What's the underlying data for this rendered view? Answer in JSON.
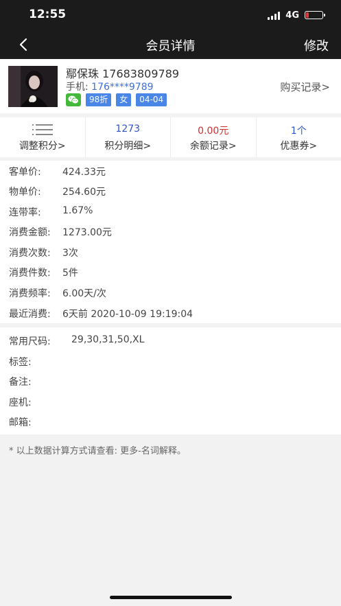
{
  "status_bar": {
    "time": "12:55",
    "network": "4G",
    "battery_color": "#e0383a"
  },
  "nav": {
    "title": "会员详情",
    "edit_label": "修改",
    "back_icon": "chevron-left-icon"
  },
  "profile": {
    "name_line": "鄢保珠 17683809789",
    "phone_label": "手机:",
    "phone_value": "176****9789",
    "tags": [
      "98折",
      "女",
      "04-04"
    ],
    "buy_record_label": "购买记录>"
  },
  "stats": [
    {
      "value": "",
      "label": "调整积分>",
      "color": "#333333"
    },
    {
      "value": "1273",
      "label": "积分明细>",
      "color": "#2d55c9"
    },
    {
      "value": "0.00元",
      "label": "余额记录>",
      "color": "#d22f2f"
    },
    {
      "value": "1个",
      "label": "优惠券>",
      "color": "#2d55c9"
    }
  ],
  "metrics": [
    {
      "label": "客单价:",
      "value": "424.33元"
    },
    {
      "label": "物单价:",
      "value": "254.60元"
    },
    {
      "label": "连带率:",
      "value": "1.67%"
    },
    {
      "label": "消费金额:",
      "value": "1273.00元"
    },
    {
      "label": "消费次数:",
      "value": "3次"
    },
    {
      "label": "消费件数:",
      "value": "5件"
    },
    {
      "label": "消费频率:",
      "value": "6.00天/次"
    },
    {
      "label": "最近消费:",
      "value": "6天前 2020-10-09 19:19:04"
    }
  ],
  "info": [
    {
      "label": "常用尺码:",
      "value": "29,30,31,50,XL"
    },
    {
      "label": "标签:",
      "value": ""
    },
    {
      "label": "备注:",
      "value": ""
    },
    {
      "label": "座机:",
      "value": ""
    },
    {
      "label": "邮箱:",
      "value": ""
    }
  ],
  "note": "* 以上数据计算方式请查看: 更多-名词解释。"
}
